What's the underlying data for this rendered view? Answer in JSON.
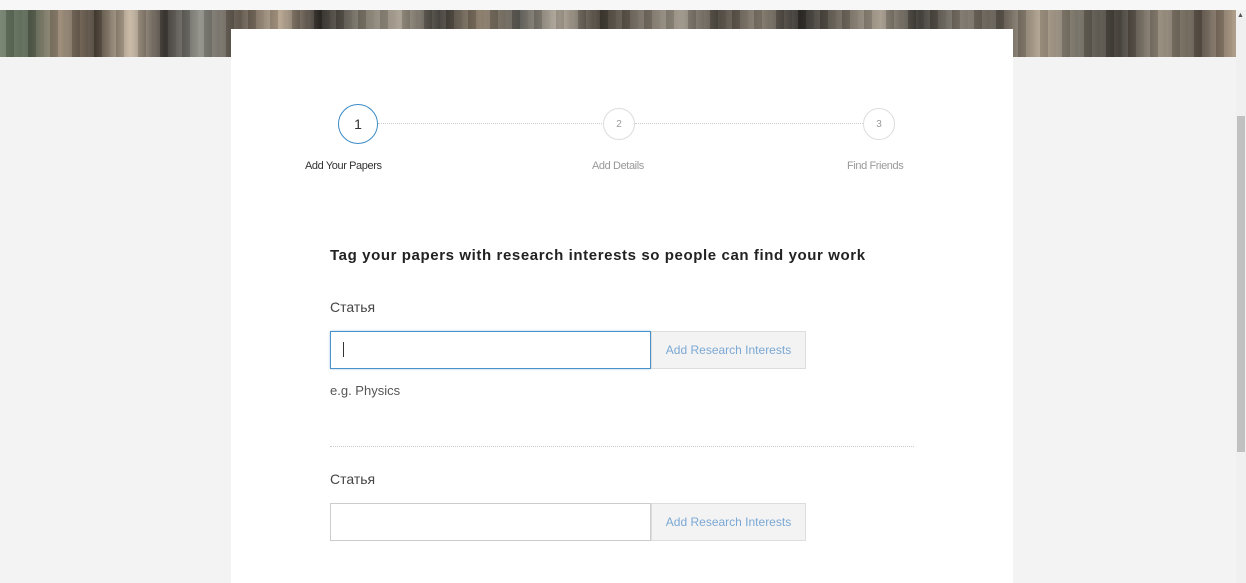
{
  "stepper": {
    "steps": [
      {
        "number": "1",
        "label": "Add Your Papers",
        "state": "active"
      },
      {
        "number": "2",
        "label": "Add Details",
        "state": "inactive"
      },
      {
        "number": "3",
        "label": "Find Friends",
        "state": "inactive"
      }
    ]
  },
  "main": {
    "heading": "Tag your papers with research interests so people can find your work",
    "papers": [
      {
        "title": "Статья",
        "input_value": "",
        "button_label": "Add Research Interests",
        "hint": "e.g. Physics"
      },
      {
        "title": "Статья",
        "input_value": "",
        "button_label": "Add Research Interests"
      }
    ]
  },
  "colors": {
    "accent": "#3a8bc6",
    "button_text": "#7aa8d4"
  }
}
